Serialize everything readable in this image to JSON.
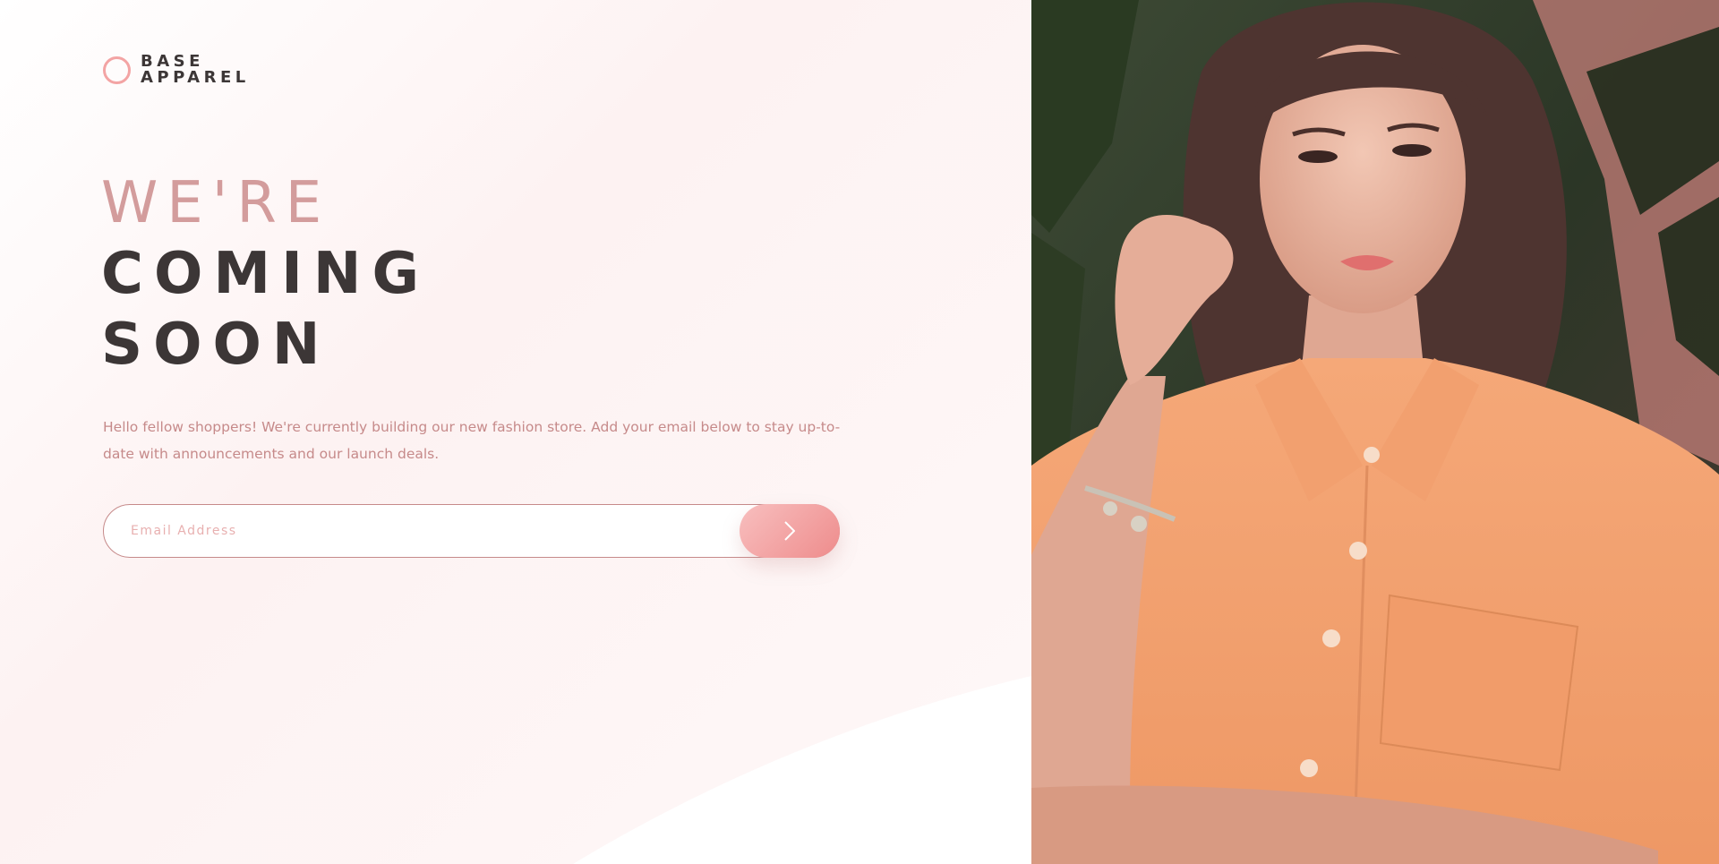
{
  "brand": {
    "line1": "BASE",
    "line2": "APPAREL",
    "accent": "#f3a4a4",
    "dark": "#3c3636",
    "muted": "#c68a8a"
  },
  "hero": {
    "light": "WE'RE",
    "bold1": "COMING",
    "bold2": "SOON"
  },
  "description": "Hello fellow shoppers! We're currently building our new fashion store. Add your email below to stay up-to-date with announcements and our launch deals.",
  "form": {
    "email_placeholder": "Email Address",
    "submit_icon": "chevron-right-icon"
  },
  "hero_image": {
    "icon": "photo-of-woman-in-orange-shirt"
  }
}
